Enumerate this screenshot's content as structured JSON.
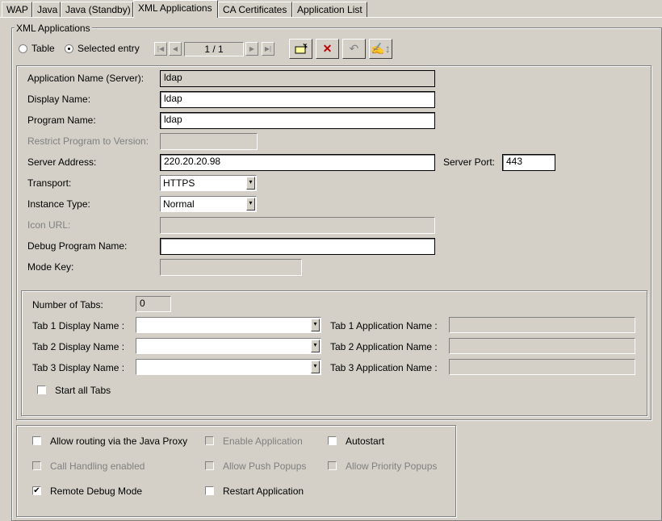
{
  "tabs": [
    "WAP",
    "Java",
    "Java (Standby)",
    "XML Applications",
    "CA Certificates",
    "Application List"
  ],
  "group_title": "XML Applications",
  "view": {
    "table_label": "Table",
    "selected_label": "Selected entry",
    "selected": "Selected entry",
    "page_indicator": "1 / 1"
  },
  "form": {
    "app_name_label": "Application Name (Server):",
    "app_name": "ldap",
    "display_name_label": "Display Name:",
    "display_name": "ldap",
    "program_name_label": "Program Name:",
    "program_name": "ldap",
    "restrict_version_label": "Restrict Program to Version:",
    "restrict_version": "",
    "server_address_label": "Server Address:",
    "server_address": "220.20.20.98",
    "server_port_label": "Server Port:",
    "server_port": "443",
    "transport_label": "Transport:",
    "transport": "HTTPS",
    "instance_type_label": "Instance Type:",
    "instance_type": "Normal",
    "icon_url_label": "Icon URL:",
    "icon_url": "",
    "debug_program_label": "Debug Program Name:",
    "debug_program": "",
    "mode_key_label": "Mode Key:",
    "mode_key": ""
  },
  "tabs_config": {
    "number_label": "Number of Tabs:",
    "number": "0",
    "tab1_display_label": "Tab 1 Display Name :",
    "tab1_app_label": "Tab 1 Application Name :",
    "tab2_display_label": "Tab 2 Display Name :",
    "tab2_app_label": "Tab 2 Application Name :",
    "tab3_display_label": "Tab 3 Display Name :",
    "tab3_app_label": "Tab 3 Application Name :",
    "start_all_label": "Start all Tabs"
  },
  "options": {
    "allow_routing": "Allow routing via the Java Proxy",
    "enable_app": "Enable Application",
    "autostart": "Autostart",
    "call_handling": "Call Handling enabled",
    "allow_push": "Allow Push Popups",
    "allow_priority": "Allow Priority Popups",
    "remote_debug": "Remote Debug Mode",
    "restart_app": "Restart Application"
  }
}
